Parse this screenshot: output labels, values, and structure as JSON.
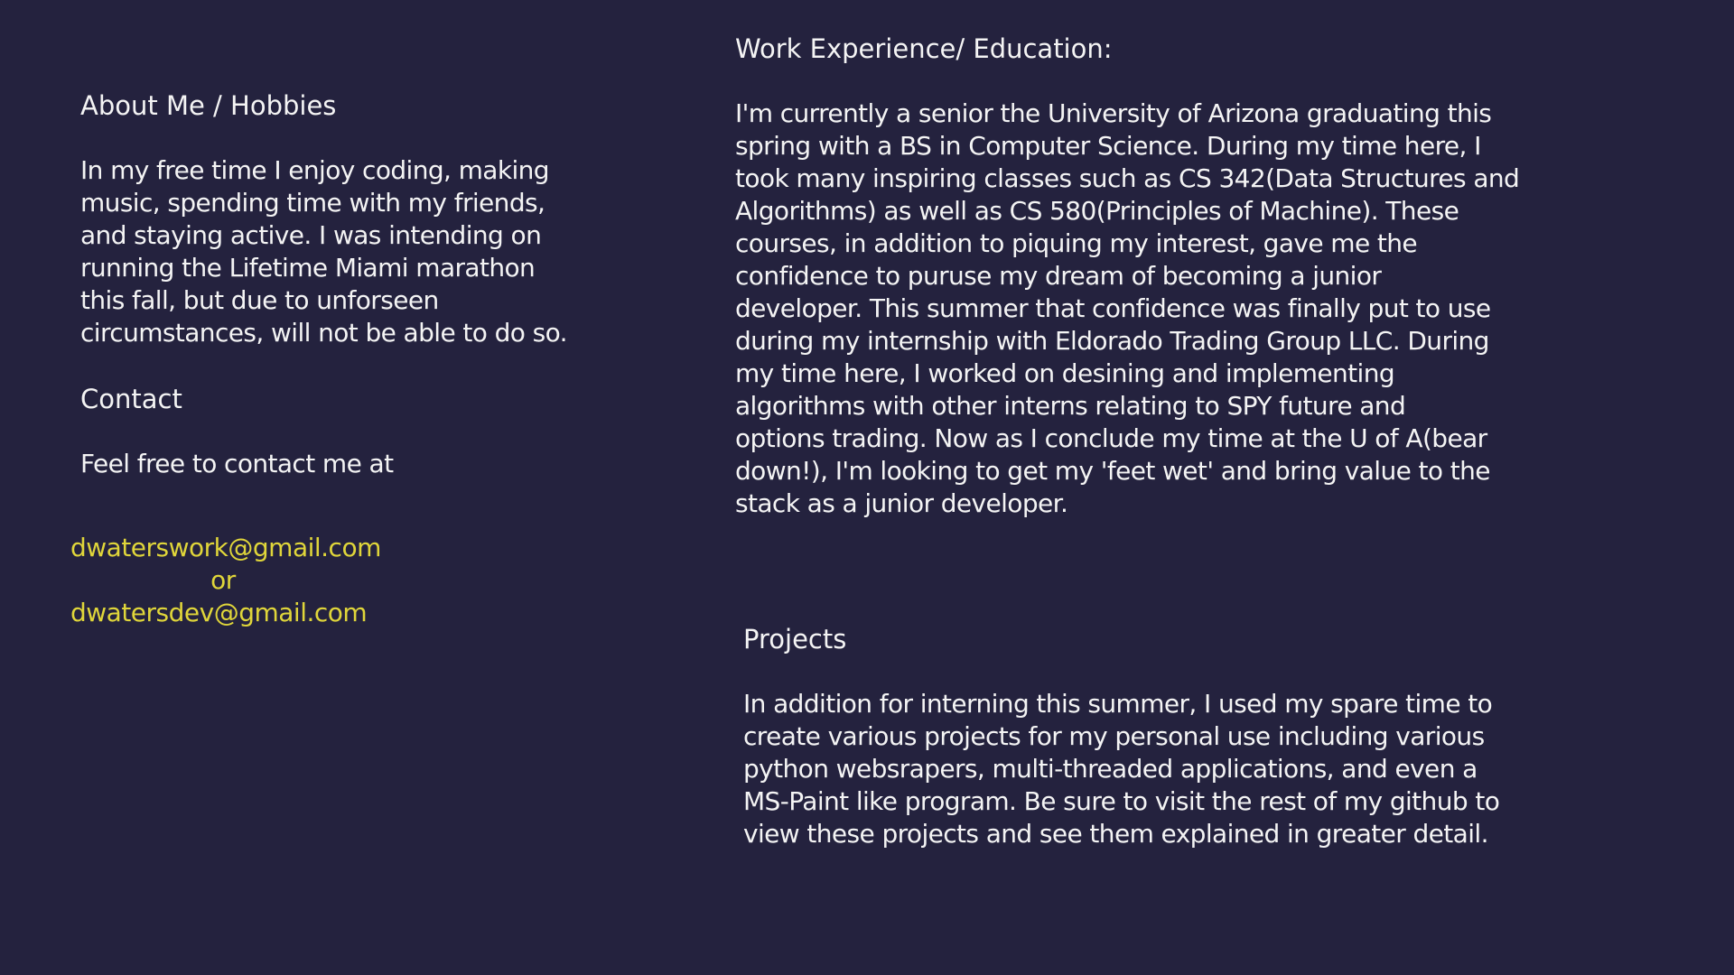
{
  "about": {
    "heading": "About Me / Hobbies",
    "lines": [
      "In my free time I enjoy coding, making",
      "music, spending time with my friends,",
      "and staying active. I was intending on",
      "running the Lifetime Miami marathon",
      "this fall, but due to unforseen",
      "circumstances, will not be able to do so."
    ]
  },
  "contact": {
    "heading": "Contact",
    "text": "Feel free to contact me at",
    "email_primary": "dwaterswork@gmail.com",
    "separator": "or",
    "email_secondary": "dwatersdev@gmail.com"
  },
  "work": {
    "heading": "Work Experience/ Education:",
    "lines": [
      "I'm currently a senior the University of Arizona graduating this",
      "spring with a BS in Computer Science. During my time here, I",
      "took many inspiring classes such as CS 342(Data Structures and",
      "Algorithms) as well as CS 580(Principles of Machine). These",
      "courses, in addition to piquing my interest, gave me the",
      "confidence to puruse my dream of becoming a junior",
      "developer. This summer that confidence was finally put to use",
      "during my internship with Eldorado Trading Group LLC. During",
      "my time here, I worked on desining and implementing",
      "algorithms with other interns relating to SPY future and",
      "options trading. Now as I conclude my time at the U of A(bear",
      "down!), I'm looking to get my 'feet wet' and bring value to the",
      "stack as a junior developer."
    ]
  },
  "projects": {
    "heading": "Projects",
    "lines": [
      "In addition for interning this summer, I used my spare time to",
      "create various projects for my personal use including various",
      "python websrapers, multi-threaded applications, and even a",
      "MS-Paint like program. Be sure to visit the rest of my github to",
      "view these projects and see them explained in greater detail."
    ]
  },
  "colors": {
    "background": "#24223e",
    "text": "#f4f4f4",
    "link": "#e0d63a"
  }
}
